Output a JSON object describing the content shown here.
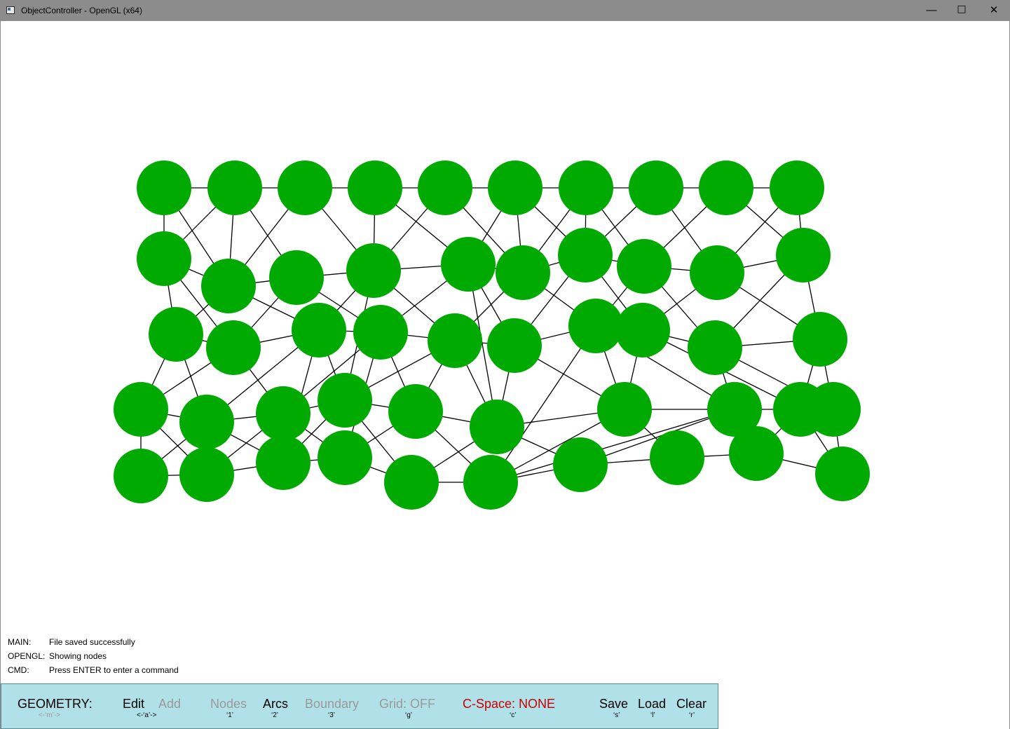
{
  "window": {
    "title": "ObjectController - OpenGL (x64)",
    "minimize_glyph": "—",
    "maximize_glyph": "☐",
    "close_glyph": "✕"
  },
  "graph": {
    "node_color": "#00aa00",
    "edge_color": "#000000",
    "nodes": [],
    "edges": []
  },
  "status": {
    "main": {
      "key": "MAIN:",
      "value": "File saved successfully"
    },
    "opengl": {
      "key": "OPENGL:",
      "value": "Showing nodes"
    },
    "cmd": {
      "key": "CMD:",
      "value": "Press ENTER to enter a command"
    }
  },
  "toolbar": {
    "background": "#b0e0e8",
    "geometry": {
      "label": "GEOMETRY:",
      "hotkey": "<-‘m’->"
    },
    "edit": {
      "label": "Edit"
    },
    "add": {
      "label": "Add"
    },
    "edit_add_hotkey": "<-‘a’->",
    "nodes": {
      "label": "Nodes",
      "hotkey": "‘1’"
    },
    "arcs": {
      "label": "Arcs",
      "hotkey": "‘2’"
    },
    "boundary": {
      "label": "Boundary",
      "hotkey": "‘3’"
    },
    "grid": {
      "label": "Grid: OFF",
      "hotkey": "‘g’"
    },
    "cspace": {
      "label": "C-Space: NONE",
      "hotkey": "‘c’"
    },
    "save": {
      "label": "Save",
      "hotkey": "‘s’"
    },
    "load": {
      "label": "Load",
      "hotkey": "‘l’"
    },
    "clear": {
      "label": "Clear",
      "hotkey": "‘r’"
    }
  }
}
